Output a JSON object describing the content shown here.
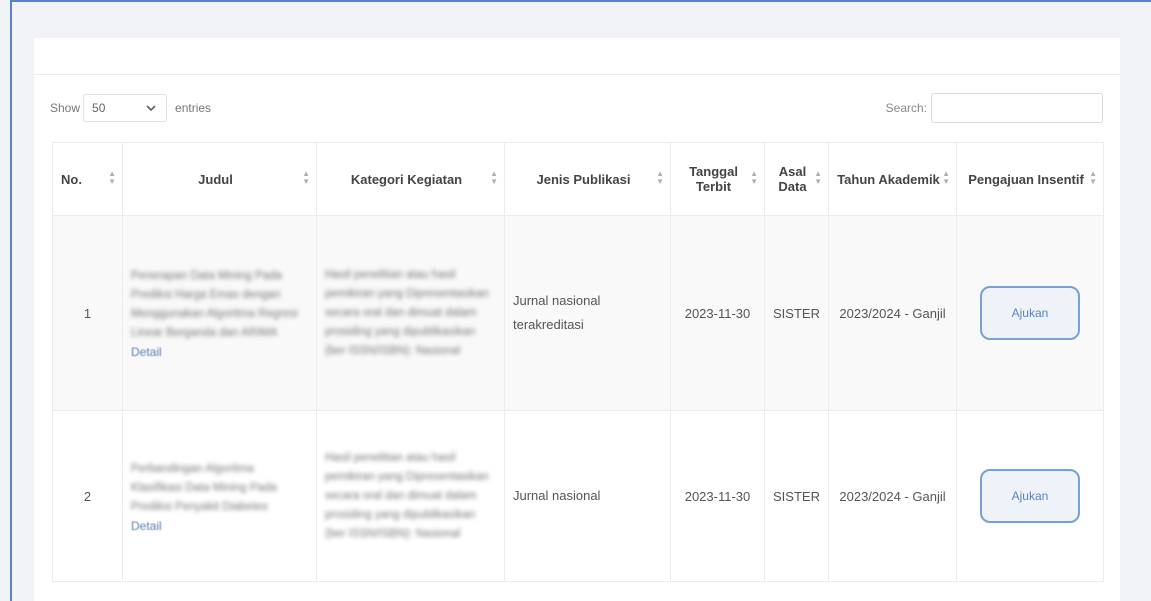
{
  "controls": {
    "show_label": "Show",
    "entries_value": "50",
    "entries_label": "entries",
    "search_label": "Search:",
    "search_value": ""
  },
  "table": {
    "columns": [
      "No.",
      "Judul",
      "Kategori Kegiatan",
      "Jenis Publikasi",
      "Tanggal Terbit",
      "Asal Data",
      "Tahun Akademik",
      "Pengajuan Insentif"
    ],
    "rows": [
      {
        "no": "1",
        "judul": "Penerapan Data Mining Pada Prediksi Harga Emas dengan Menggunakan Algoritma Regresi Linear Berganda dan ARIMA",
        "detail": "Detail",
        "kategori": "Hasil penelitian atau hasil pemikiran yang Dipresentasikan secara oral dan dimuat dalam prosiding yang dipublikasikan (ber ISSN/ISBN): Nasional",
        "jenis": "Jurnal nasional terakreditasi",
        "tanggal": "2023-11-30",
        "asal": "SISTER",
        "tahun": "2023/2024 - Ganjil",
        "aksi": "Ajukan"
      },
      {
        "no": "2",
        "judul": "Perbandingan Algoritma Klasifikasi Data Mining Pada Prediksi Penyakit Diabetes",
        "detail": "Detail",
        "kategori": "Hasil penelitian atau hasil pemikiran yang Dipresentasikan secara oral dan dimuat dalam prosiding yang dipublikasikan (ber ISSN/ISBN): Nasional",
        "jenis": "Jurnal nasional",
        "tanggal": "2023-11-30",
        "asal": "SISTER",
        "tahun": "2023/2024 - Ganjil",
        "aksi": "Ajukan"
      }
    ]
  },
  "icons": {
    "entries_dropdown": "chevron-down-icon",
    "sort": "sort-arrows-icon"
  },
  "colors": {
    "frame": "#5b82c4",
    "button_border": "#7aa0d4",
    "link": "#5b7fb4"
  }
}
